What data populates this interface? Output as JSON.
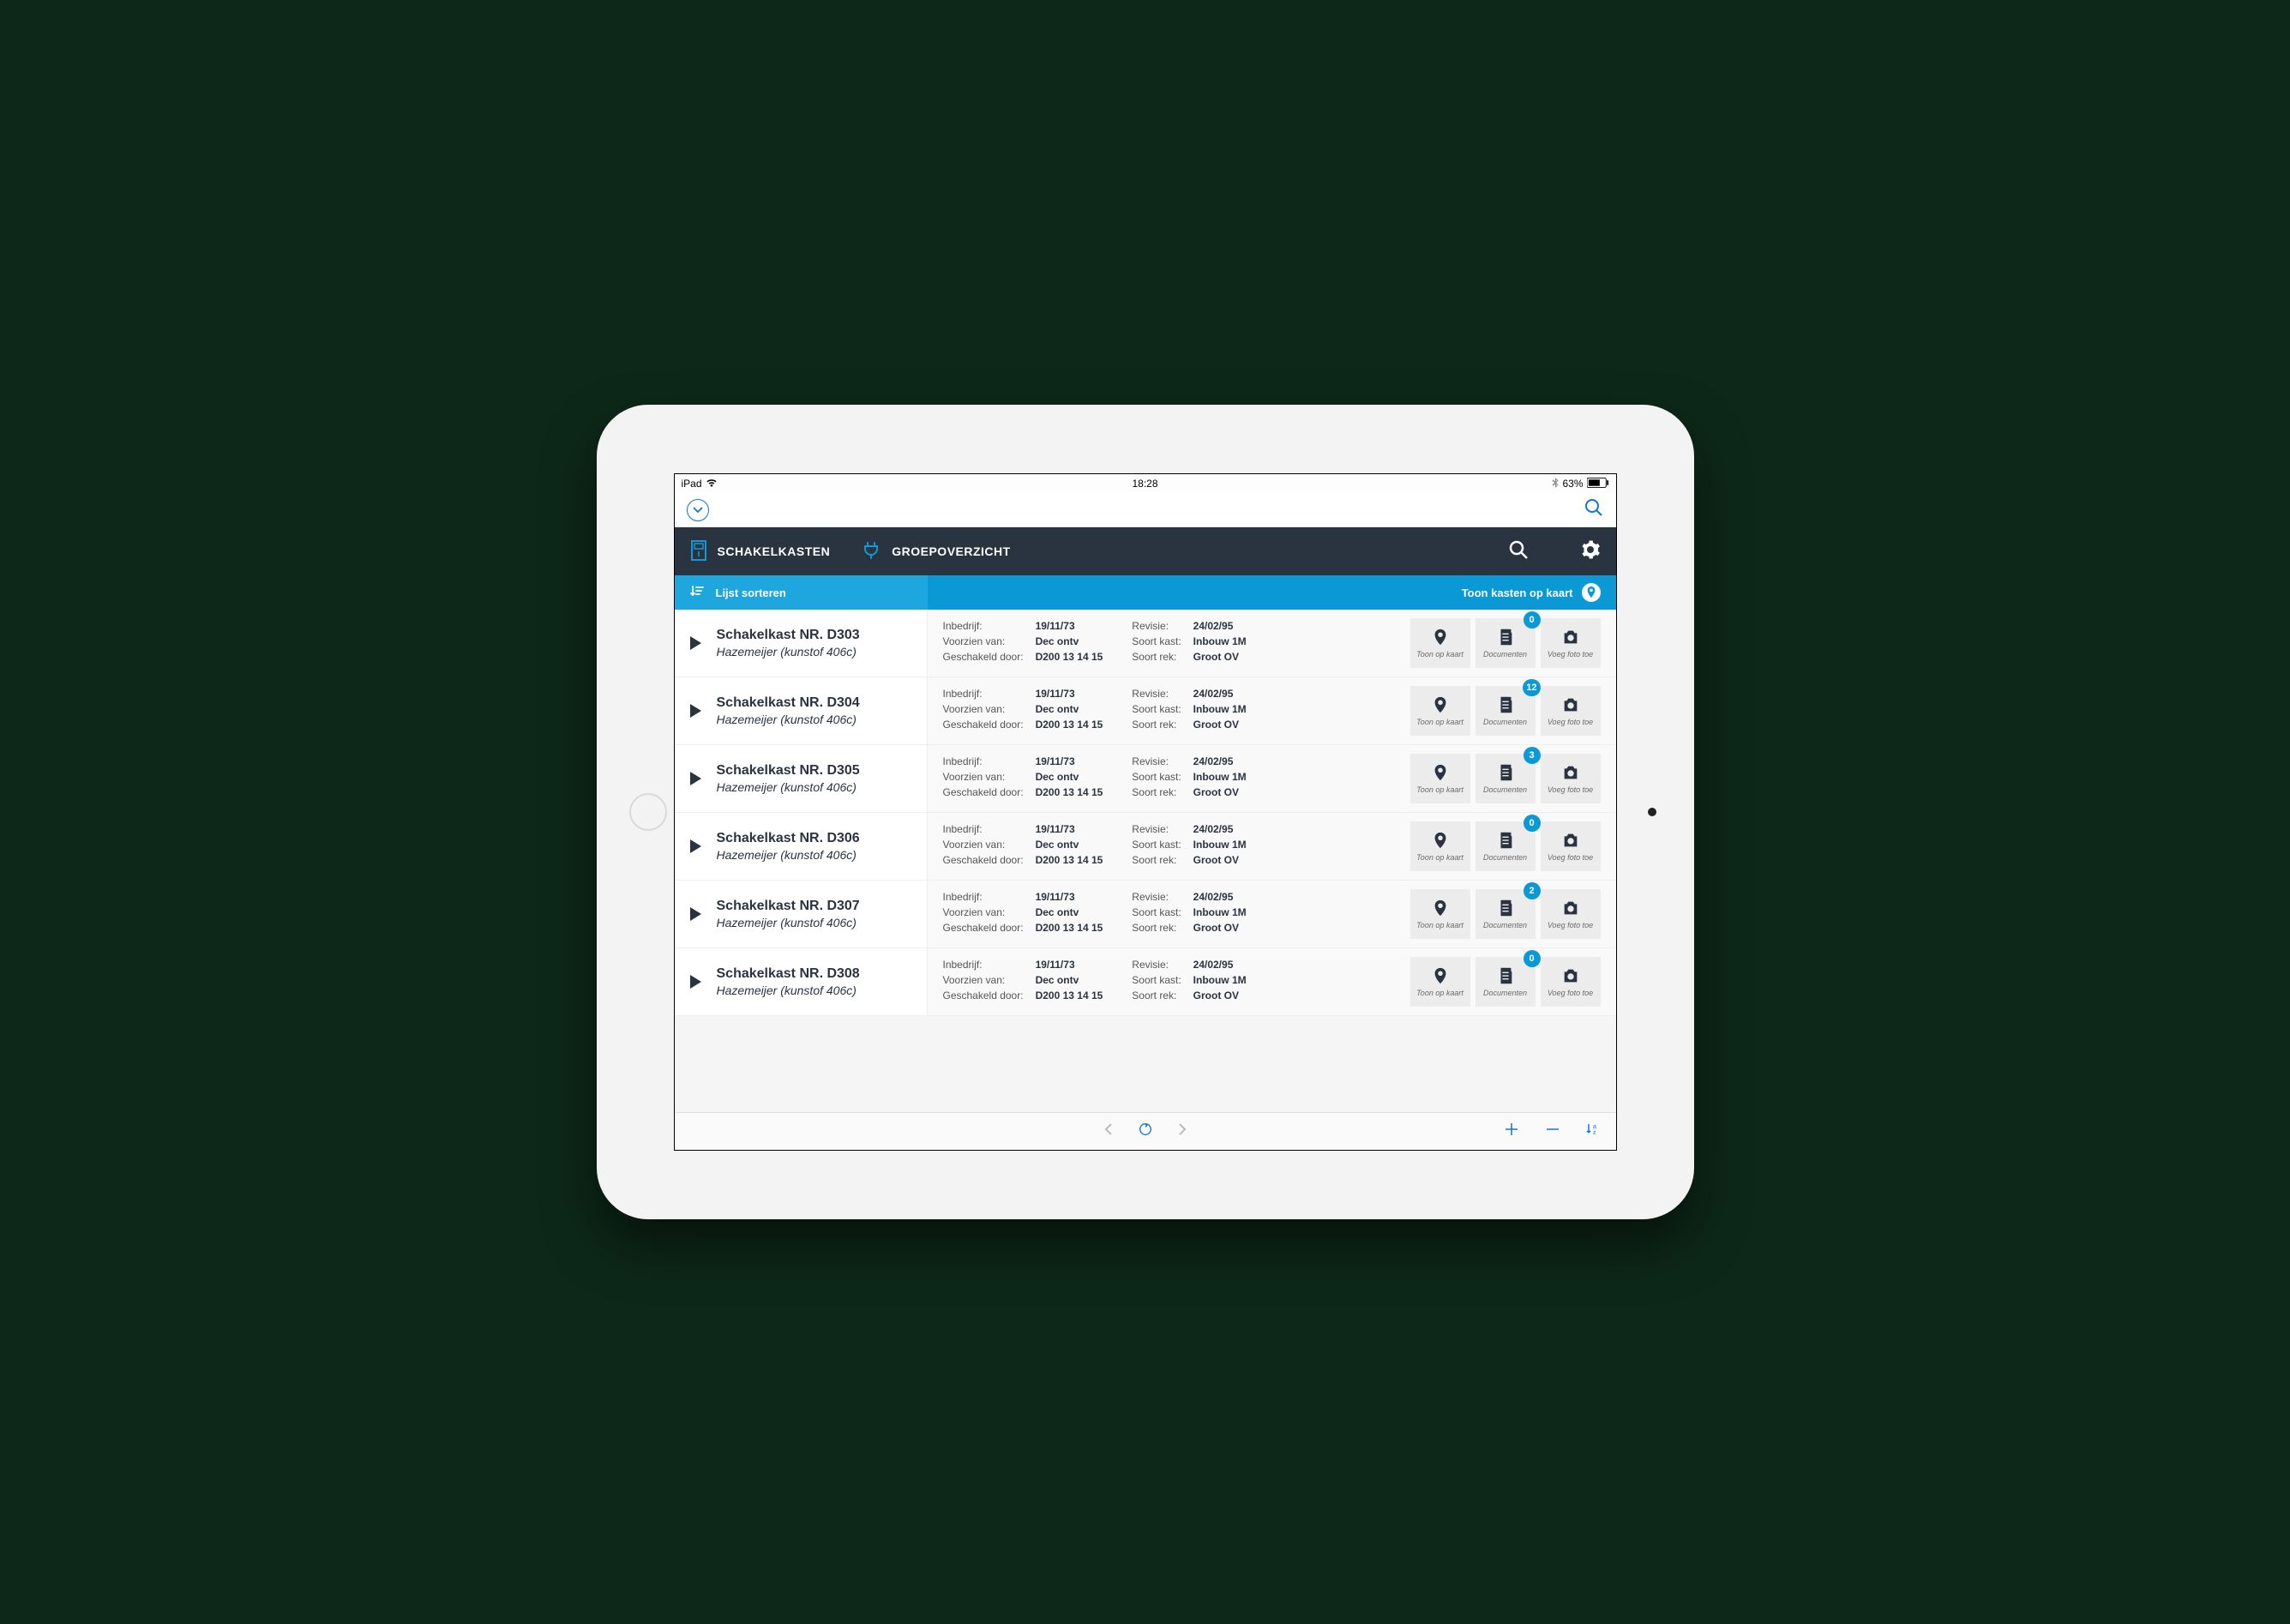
{
  "ios_status": {
    "device": "iPad",
    "time": "18:28",
    "battery": "63%"
  },
  "header": {
    "tab_schakelkasten": "SCHAKELKASTEN",
    "tab_groepoverzicht": "GROEPOVERZICHT"
  },
  "toolbar": {
    "sort_label": "Lijst sorteren",
    "map_label": "Toon kasten op kaart"
  },
  "actions": {
    "map": "Toon op kaart",
    "docs": "Documenten",
    "photo": "Voeg foto toe"
  },
  "labels": {
    "inbedrijf": "Inbedrijf:",
    "voorzien": "Voorzien van:",
    "geschakeld": "Geschakeld door:",
    "revisie": "Revisie:",
    "soort_kast": "Soort kast:",
    "soort_rek": "Soort rek:"
  },
  "rows": [
    {
      "title": "Schakelkast NR. D303",
      "subtitle": "Hazemeijer (kunstof 406c)",
      "inbedrijf": "19/11/73",
      "voorzien": "Dec ontv",
      "geschakeld": "D200 13 14 15",
      "revisie": "24/02/95",
      "soort_kast": "Inbouw 1M",
      "soort_rek": "Groot OV",
      "docs": "0"
    },
    {
      "title": "Schakelkast NR. D304",
      "subtitle": "Hazemeijer (kunstof 406c)",
      "inbedrijf": "19/11/73",
      "voorzien": "Dec ontv",
      "geschakeld": "D200 13 14 15",
      "revisie": "24/02/95",
      "soort_kast": "Inbouw 1M",
      "soort_rek": "Groot OV",
      "docs": "12"
    },
    {
      "title": "Schakelkast NR. D305",
      "subtitle": "Hazemeijer (kunstof 406c)",
      "inbedrijf": "19/11/73",
      "voorzien": "Dec ontv",
      "geschakeld": "D200 13 14 15",
      "revisie": "24/02/95",
      "soort_kast": "Inbouw 1M",
      "soort_rek": "Groot OV",
      "docs": "3"
    },
    {
      "title": "Schakelkast NR. D306",
      "subtitle": "Hazemeijer (kunstof 406c)",
      "inbedrijf": "19/11/73",
      "voorzien": "Dec ontv",
      "geschakeld": "D200 13 14 15",
      "revisie": "24/02/95",
      "soort_kast": "Inbouw 1M",
      "soort_rek": "Groot OV",
      "docs": "0"
    },
    {
      "title": "Schakelkast NR. D307",
      "subtitle": "Hazemeijer (kunstof 406c)",
      "inbedrijf": "19/11/73",
      "voorzien": "Dec ontv",
      "geschakeld": "D200 13 14 15",
      "revisie": "24/02/95",
      "soort_kast": "Inbouw 1M",
      "soort_rek": "Groot OV",
      "docs": "2"
    },
    {
      "title": "Schakelkast NR. D308",
      "subtitle": "Hazemeijer (kunstof 406c)",
      "inbedrijf": "19/11/73",
      "voorzien": "Dec ontv",
      "geschakeld": "D200 13 14 15",
      "revisie": "24/02/95",
      "soort_kast": "Inbouw 1M",
      "soort_rek": "Groot OV",
      "docs": "0"
    }
  ]
}
